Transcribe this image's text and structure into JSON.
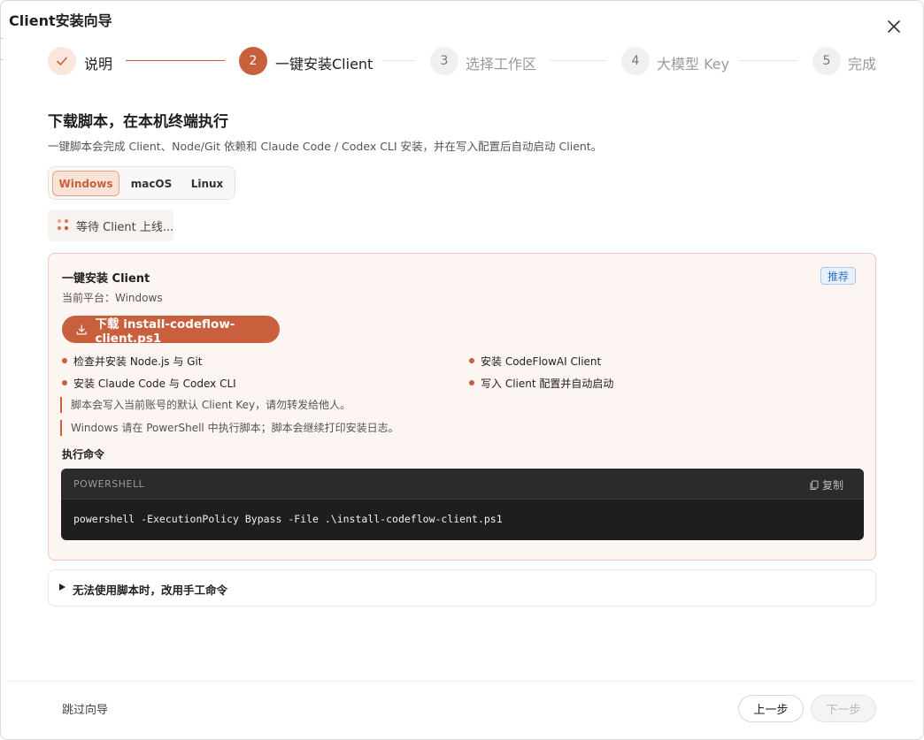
{
  "dialog": {
    "title": "Client安装向导"
  },
  "steps": [
    {
      "number": "",
      "label": "说明",
      "state": "done"
    },
    {
      "number": "2",
      "label": "一键安装Client",
      "state": "active"
    },
    {
      "number": "3",
      "label": "选择工作区",
      "state": "pending"
    },
    {
      "number": "4",
      "label": "大模型 Key",
      "state": "pending"
    },
    {
      "number": "5",
      "label": "完成",
      "state": "pending"
    }
  ],
  "section": {
    "title": "下载脚本，在本机终端执行",
    "description": "一键脚本会完成 Client、Node/Git 依赖和 Claude Code / Codex CLI 安装，并在写入配置后自动启动 Client。"
  },
  "os_tabs": {
    "options": [
      "Windows",
      "macOS",
      "Linux"
    ],
    "selected": "Windows"
  },
  "status": {
    "waiting_text": "等待 Client 上线..."
  },
  "install_card": {
    "title": "一键安装 Client",
    "platform": "当前平台：Windows",
    "badge": "推荐",
    "download_label": "下载 install-codeflow-client.ps1",
    "bullets": [
      "检查并安装 Node.js 与 Git",
      "安装 CodeFlowAI Client",
      "安装 Claude Code 与 Codex CLI",
      "写入 Client 配置并自动启动"
    ],
    "notes": [
      "脚本会写入当前账号的默认 Client Key，请勿转发给他人。",
      "Windows 请在 PowerShell 中执行脚本；脚本会继续打印安装日志。"
    ],
    "command_label": "执行命令",
    "code_language": "POWERSHELL",
    "copy_label": "复制",
    "command": "powershell -ExecutionPolicy Bypass -File .\\install-codeflow-client.ps1"
  },
  "manual": {
    "label": "无法使用脚本时，改用手工命令"
  },
  "footer": {
    "skip_label": "跳过向导",
    "prev_label": "上一步",
    "next_label": "下一步"
  },
  "colors": {
    "accent": "#c8603e",
    "badge_blue": "#2f72c4",
    "code_bg": "#1e1e1e"
  }
}
